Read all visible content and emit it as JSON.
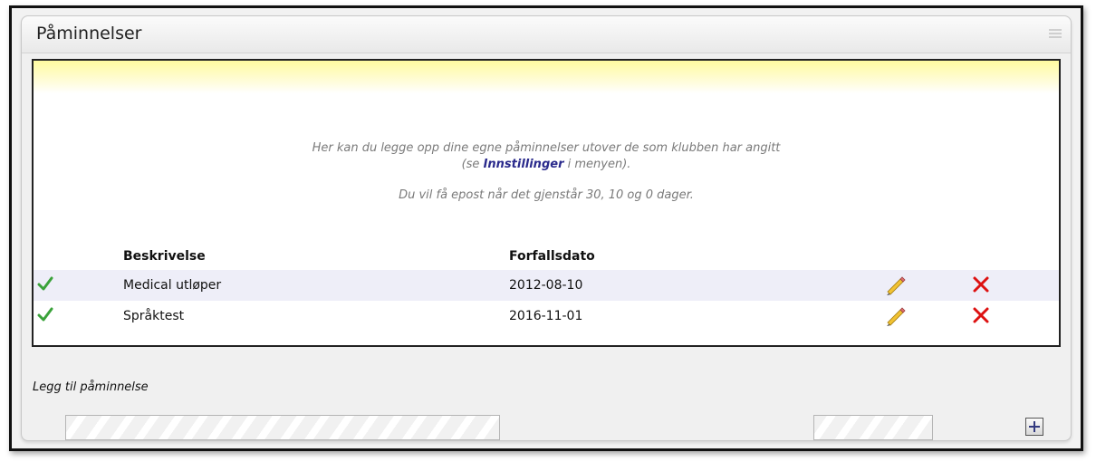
{
  "panel": {
    "title": "Påminnelser"
  },
  "info": {
    "line1": "Her kan du legge opp dine egne påminnelser utover de som klubben har angitt",
    "line2_prefix": "(se ",
    "line2_link": "Innstillinger",
    "line2_suffix": " i menyen).",
    "line3": "Du vil få epost når det gjenstår 30, 10 og 0 dager."
  },
  "table": {
    "columns": [
      "Beskrivelse",
      "Forfallsdato"
    ],
    "rows": [
      {
        "description": "Medical utløper",
        "due_date": "2012-08-10",
        "status_icon": "check-icon",
        "edit_icon": "pencil-icon",
        "delete_icon": "close-icon"
      },
      {
        "description": "Språktest",
        "due_date": "2016-11-01",
        "status_icon": "check-icon",
        "edit_icon": "pencil-icon",
        "delete_icon": "close-icon"
      }
    ]
  },
  "add_form": {
    "label": "Legg til påminnelse",
    "description_value": "",
    "date_value": "",
    "add_icon": "plus-icon"
  },
  "colors": {
    "check": "#3aa23a",
    "delete": "#dd1111",
    "link": "#2a2a8c",
    "highlight_row": "#eeeef8",
    "banner": "#fffba0"
  }
}
